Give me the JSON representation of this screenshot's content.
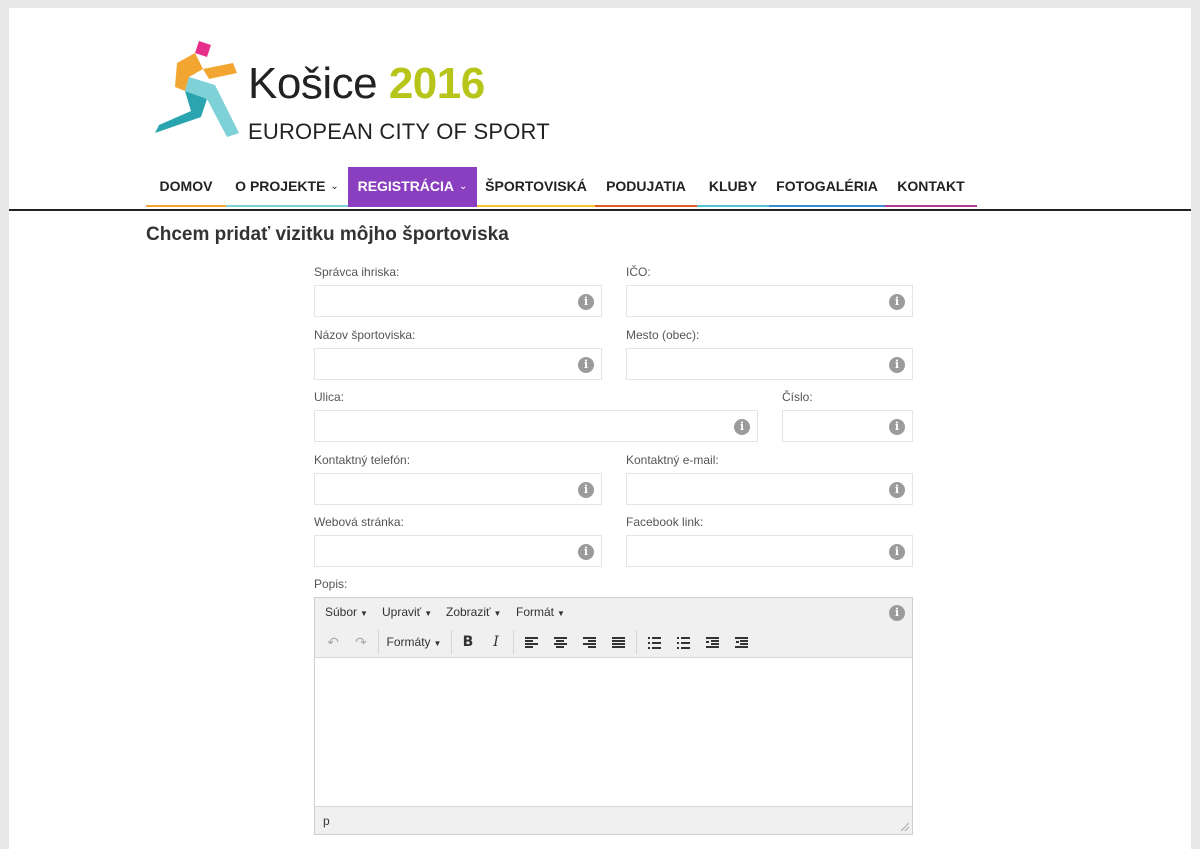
{
  "logo": {
    "city": "Košice",
    "year": "2016",
    "subtitle": "EUROPEAN CITY OF SPORT",
    "colors": {
      "magenta": "#e62f8b",
      "orange": "#f3a531",
      "teal": "#2aa5b0",
      "lightblue": "#7fd1d8",
      "lime": "#b7c51a"
    }
  },
  "nav": {
    "items": [
      {
        "label": "DOMOV",
        "underline": "#f3a531",
        "dropdown": false,
        "active": false
      },
      {
        "label": "O PROJEKTE",
        "underline": "#7fd1d8",
        "dropdown": true,
        "active": false
      },
      {
        "label": "REGISTRÁCIA",
        "underline": "#8a3fc0",
        "dropdown": true,
        "active": true
      },
      {
        "label": "ŠPORTOVISKÁ",
        "underline": "#f3c431",
        "dropdown": false,
        "active": false
      },
      {
        "label": "PODUJATIA",
        "underline": "#e55a2b",
        "dropdown": false,
        "active": false
      },
      {
        "label": "KLUBY",
        "underline": "#56c3d8",
        "dropdown": false,
        "active": false
      },
      {
        "label": "FOTOGALÉRIA",
        "underline": "#3a8fd0",
        "dropdown": false,
        "active": false
      },
      {
        "label": "KONTAKT",
        "underline": "#b33c8c",
        "dropdown": false,
        "active": false
      }
    ]
  },
  "page": {
    "title": "Chcem pridať vizitku môjho športoviska"
  },
  "form": {
    "spravca": {
      "label": "Správca ihriska:",
      "value": ""
    },
    "ico": {
      "label": "IČO:",
      "value": ""
    },
    "nazov": {
      "label": "Názov športoviska:",
      "value": ""
    },
    "mesto": {
      "label": "Mesto (obec):",
      "value": ""
    },
    "ulica": {
      "label": "Ulica:",
      "value": ""
    },
    "cislo": {
      "label": "Číslo:",
      "value": ""
    },
    "telefon": {
      "label": "Kontaktný telefón:",
      "value": ""
    },
    "email": {
      "label": "Kontaktný e-mail:",
      "value": ""
    },
    "web": {
      "label": "Webová stránka:",
      "value": ""
    },
    "facebook": {
      "label": "Facebook link:",
      "value": ""
    },
    "popis": {
      "label": "Popis:"
    },
    "info_icon": "info-icon"
  },
  "editor": {
    "menu": [
      "Súbor",
      "Upraviť",
      "Zobraziť",
      "Formát"
    ],
    "formats_label": "Formáty",
    "status_path": "p",
    "toolbar_icons": [
      "undo-icon",
      "redo-icon",
      "bold-icon",
      "italic-icon",
      "align-left-icon",
      "align-center-icon",
      "align-right-icon",
      "align-justify-icon",
      "bullet-list-icon",
      "numbered-list-icon",
      "outdent-icon",
      "indent-icon"
    ]
  }
}
